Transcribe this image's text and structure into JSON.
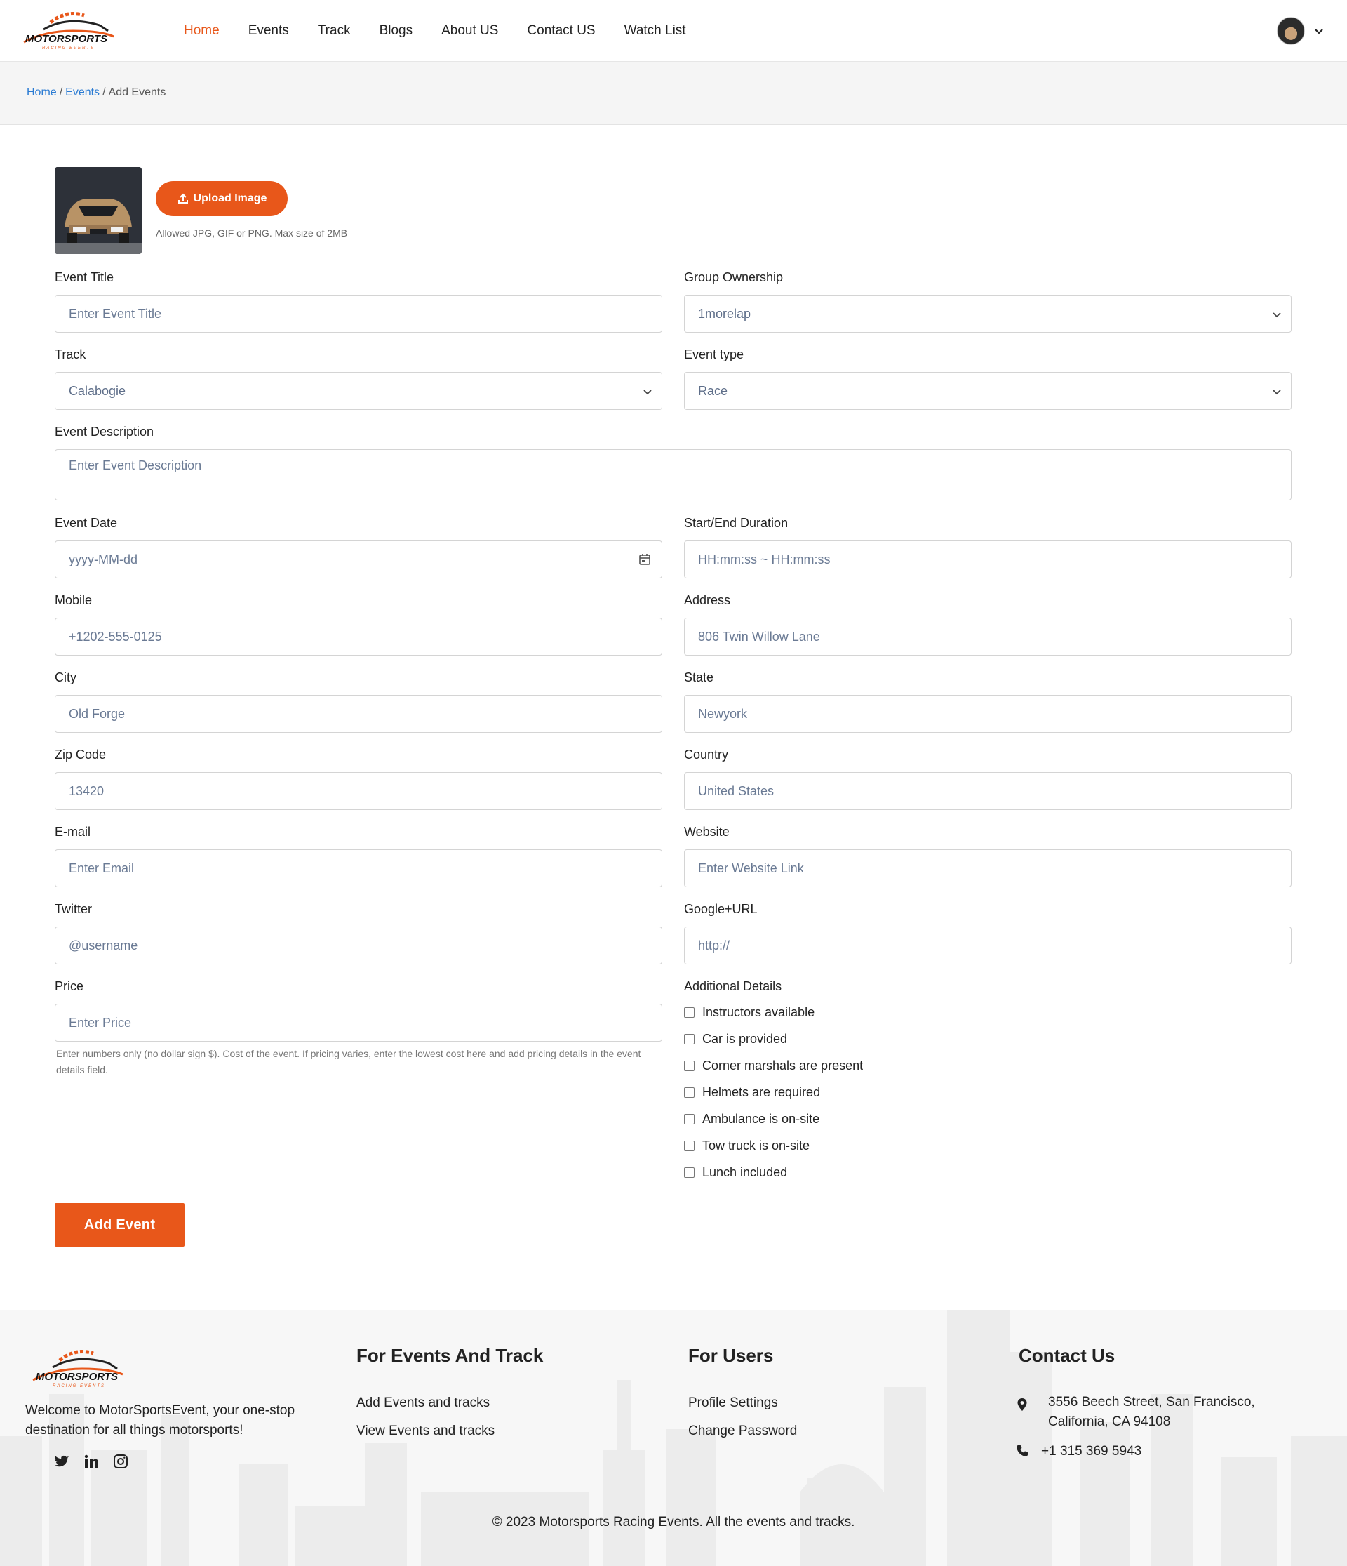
{
  "header": {
    "nav": [
      "Home",
      "Events",
      "Track",
      "Blogs",
      "About US",
      "Contact US",
      "Watch List"
    ],
    "logo_text": "MOTORSPORTS",
    "logo_sub": "RACING EVENTS"
  },
  "breadcrumb": {
    "home": "Home",
    "events": "Events",
    "sep": "/",
    "current": "Add Events"
  },
  "upload": {
    "button": "Upload Image",
    "hint": "Allowed JPG, GIF or PNG. Max size of 2MB"
  },
  "form": {
    "event_title": {
      "label": "Event Title",
      "placeholder": "Enter Event Title"
    },
    "group_ownership": {
      "label": "Group Ownership",
      "value": "1morelap"
    },
    "track": {
      "label": "Track",
      "value": "Calabogie"
    },
    "event_type": {
      "label": "Event type",
      "value": "Race"
    },
    "description": {
      "label": "Event Description",
      "placeholder": "Enter Event Description"
    },
    "event_date": {
      "label": "Event Date",
      "placeholder": "yyyy-MM-dd"
    },
    "duration": {
      "label": "Start/End Duration",
      "placeholder": "HH:mm:ss ~ HH:mm:ss"
    },
    "mobile": {
      "label": "Mobile",
      "placeholder": "+1202-555-0125"
    },
    "address": {
      "label": "Address",
      "placeholder": "806 Twin Willow Lane"
    },
    "city": {
      "label": "City",
      "placeholder": "Old Forge"
    },
    "state": {
      "label": "State",
      "placeholder": "Newyork"
    },
    "zip": {
      "label": "Zip Code",
      "placeholder": "13420"
    },
    "country": {
      "label": "Country",
      "placeholder": "United States"
    },
    "email": {
      "label": "E-mail",
      "placeholder": "Enter Email"
    },
    "website": {
      "label": "Website",
      "placeholder": "Enter Website Link"
    },
    "twitter": {
      "label": "Twitter",
      "placeholder": "@username"
    },
    "google": {
      "label": "Google+URL",
      "placeholder": "http://"
    },
    "price": {
      "label": "Price",
      "placeholder": "Enter Price",
      "hint": "Enter numbers only (no dollar sign $). Cost of the event. If pricing varies, enter the lowest cost here and add pricing details in the event details field."
    },
    "additional": {
      "label": "Additional Details",
      "options": [
        "Instructors available",
        "Car is provided",
        "Corner marshals are present",
        "Helmets are required",
        "Ambulance is on-site",
        "Tow truck is on-site",
        "Lunch included"
      ]
    },
    "submit": "Add Event"
  },
  "footer": {
    "description": "Welcome to MotorSportsEvent, your one-stop destination for all things motorsports!",
    "events_heading": "For Events And Track",
    "events_links": [
      "Add Events and tracks",
      "View Events and tracks"
    ],
    "users_heading": "For Users",
    "users_links": [
      "Profile Settings",
      "Change Password"
    ],
    "contact_heading": "Contact Us",
    "address_line1": "3556 Beech Street, San Francisco,",
    "address_line2": "California, CA 94108",
    "phone": "+1 315 369 5943",
    "copyright": "© 2023 Motorsports Racing Events. All the events and tracks."
  },
  "colors": {
    "accent": "#e8571a",
    "link": "#2a7bd3"
  }
}
